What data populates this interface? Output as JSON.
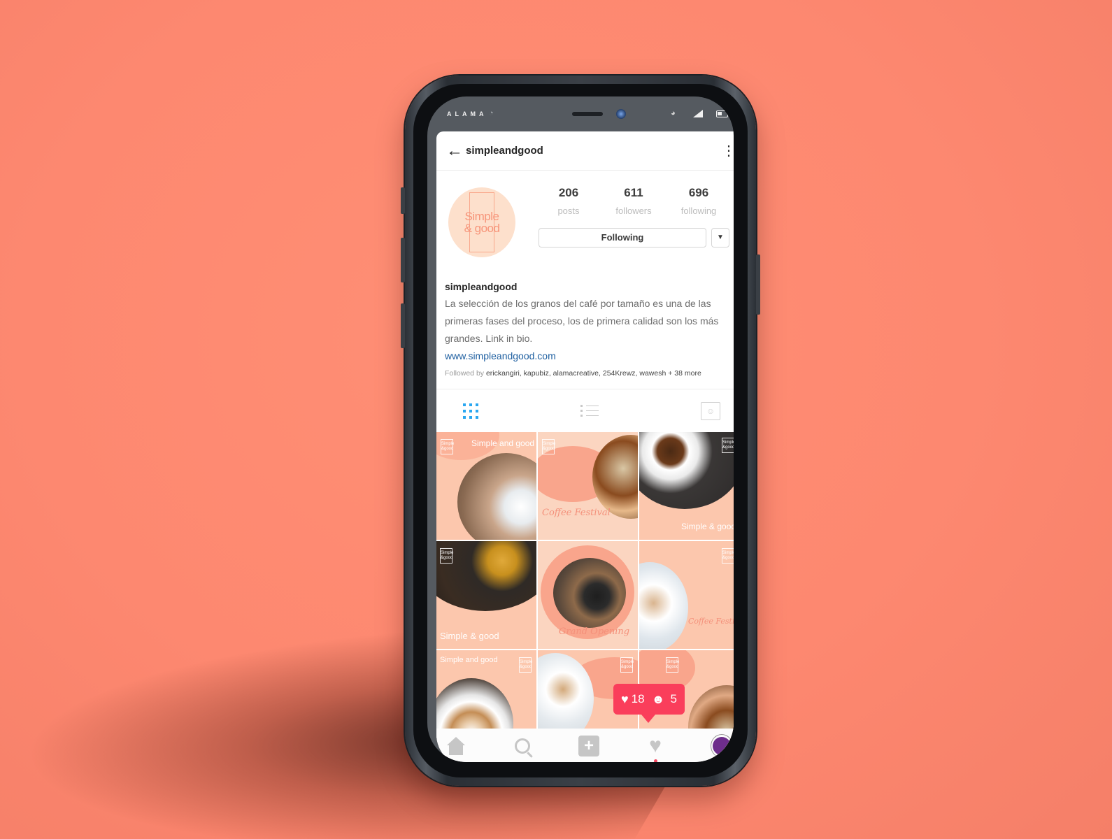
{
  "status_bar": {
    "carrier": "ALAMA",
    "icons": [
      "wifi-icon",
      "alarm-icon",
      "signal-icon",
      "battery-icon"
    ]
  },
  "header": {
    "back_icon": "arrow-left",
    "username": "simpleandgood",
    "more_icon": "vertical-ellipsis"
  },
  "profile": {
    "avatar_text": "Simple\n& good",
    "stats": [
      {
        "value": "206",
        "label": "posts"
      },
      {
        "value": "611",
        "label": "followers"
      },
      {
        "value": "696",
        "label": "following"
      }
    ],
    "follow_button": "Following",
    "dropdown_icon": "▼"
  },
  "bio": {
    "name": "simpleandgood",
    "text": "La selección de los granos del café por tamaño es una de las primeras fases del proceso, los de primera calidad son los más grandes. Link in bio.",
    "link": "www.simpleandgood.com",
    "followed_by_prefix": "Followed by",
    "followed_by_names": "erickangiri, kapubiz, alamacreative, 254Krewz, wawesh + 38 more"
  },
  "tabs": [
    {
      "name": "grid",
      "icon": "grid-icon",
      "active": true
    },
    {
      "name": "list",
      "icon": "list-icon",
      "active": false
    },
    {
      "name": "tagged",
      "icon": "tagged-icon",
      "active": false
    }
  ],
  "posts": [
    {
      "title": "Simple and good",
      "script": "",
      "logo": "Simple\n&good"
    },
    {
      "title": "",
      "script": "Coffee Festival",
      "logo": "Simple\n&good"
    },
    {
      "title": "Simple & good",
      "script": "",
      "logo": "Simple\n&good"
    },
    {
      "title": "Simple & good",
      "script": "",
      "logo": "Simple\n&good"
    },
    {
      "title": "",
      "script": "Grand Opening",
      "logo": "Simple\n&good"
    },
    {
      "title": "",
      "script": "Coffee Festival",
      "logo": "Simple\n&good"
    },
    {
      "title": "Simple and good",
      "script": "",
      "logo": "Simple\n&good"
    },
    {
      "title": "",
      "script": "",
      "logo": "Simple\n&good"
    },
    {
      "title": "",
      "script": "",
      "logo": "Simple\n&good"
    }
  ],
  "activity_badge": {
    "likes": "18",
    "follows": "5"
  },
  "bottom_nav": [
    "home",
    "search",
    "new-post",
    "activity",
    "profile"
  ],
  "colors": {
    "background": "#fd8870",
    "accent_blue": "#2aa7f1",
    "link": "#1e5fa0",
    "badge": "#fa3e5b",
    "profile_purple": "#6d2d8b"
  }
}
